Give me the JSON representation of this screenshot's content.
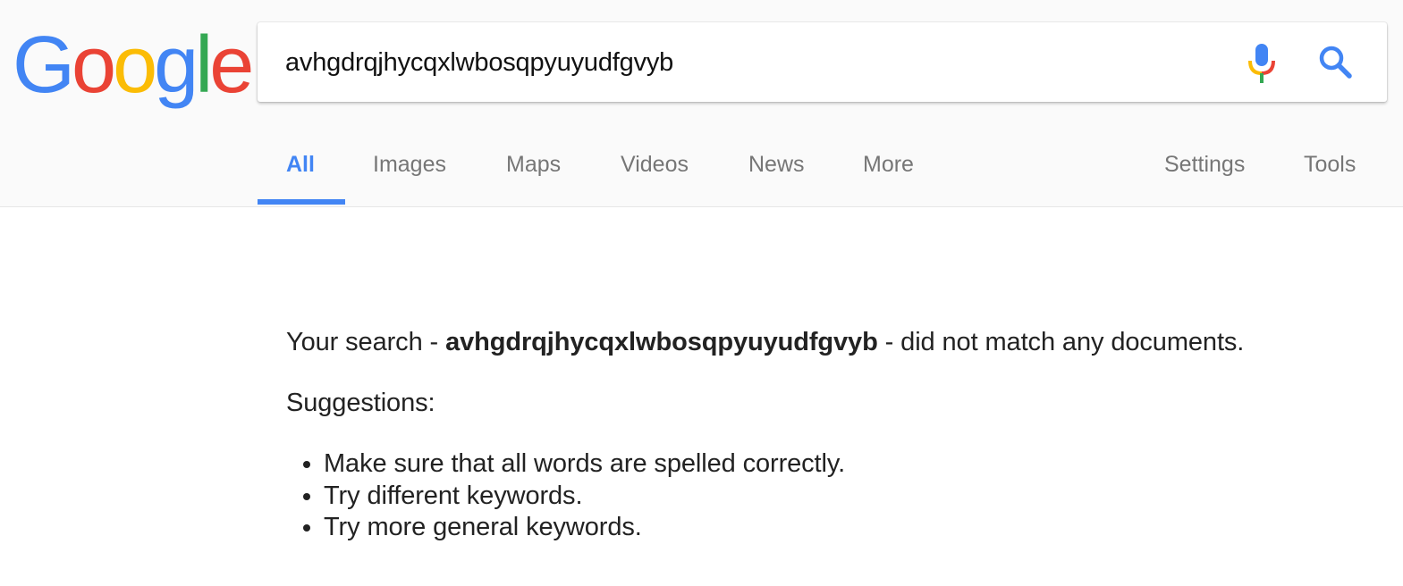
{
  "logo": {
    "text": "Google",
    "letters": [
      {
        "char": "G",
        "color": "#4285f4"
      },
      {
        "char": "o",
        "color": "#ea4335"
      },
      {
        "char": "o",
        "color": "#fbbc05"
      },
      {
        "char": "g",
        "color": "#4285f4"
      },
      {
        "char": "l",
        "color": "#34a853"
      },
      {
        "char": "e",
        "color": "#ea4335"
      }
    ]
  },
  "search": {
    "value": "avhgdrqjhycqxlwbosqpyuyudfgvyb",
    "mic_icon": "microphone-icon",
    "search_icon": "search-icon"
  },
  "tabs": {
    "all": "All",
    "images": "Images",
    "maps": "Maps",
    "videos": "Videos",
    "news": "News",
    "more": "More",
    "settings": "Settings",
    "tools": "Tools",
    "active": "All"
  },
  "results": {
    "prefix": "Your search - ",
    "query": "avhgdrqjhycqxlwbosqpyuyudfgvyb",
    "suffix": " - did not match any documents.",
    "suggestions_title": "Suggestions:",
    "suggestions": [
      "Make sure that all words are spelled correctly.",
      "Try different keywords.",
      "Try more general keywords."
    ]
  },
  "colors": {
    "blue": "#4285f4",
    "red": "#ea4335",
    "yellow": "#fbbc05",
    "green": "#34a853",
    "tab_text": "#767676",
    "header_bg": "#fafafa"
  }
}
